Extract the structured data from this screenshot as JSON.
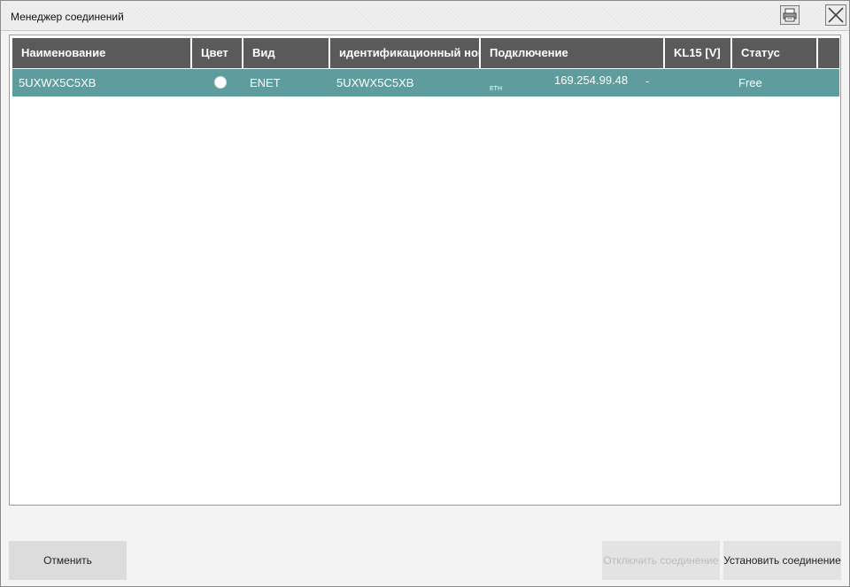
{
  "window": {
    "title": "Менеджер соединений"
  },
  "table": {
    "headers": [
      "Наименование",
      "Цвет",
      "Вид",
      "идентификационный номер",
      "Подключение",
      "KL15 [V]",
      "Статус"
    ],
    "rows": [
      {
        "name": "5UXWX5C5XB",
        "color": "white",
        "type": "ENET",
        "vin": "5UXWX5C5XB",
        "connection_tag": "ETH",
        "connection_ip": "169.254.99.48",
        "kl15": "-",
        "status": "Free"
      }
    ]
  },
  "buttons": {
    "cancel": "Отменить",
    "disconnect": "Отключить соединение",
    "connect": "Установить соединение"
  },
  "colors": {
    "header": "#5a5a5a",
    "selected_row": "#5f9c9e"
  },
  "icons": {
    "print": "printer-icon",
    "close": "close-icon"
  }
}
